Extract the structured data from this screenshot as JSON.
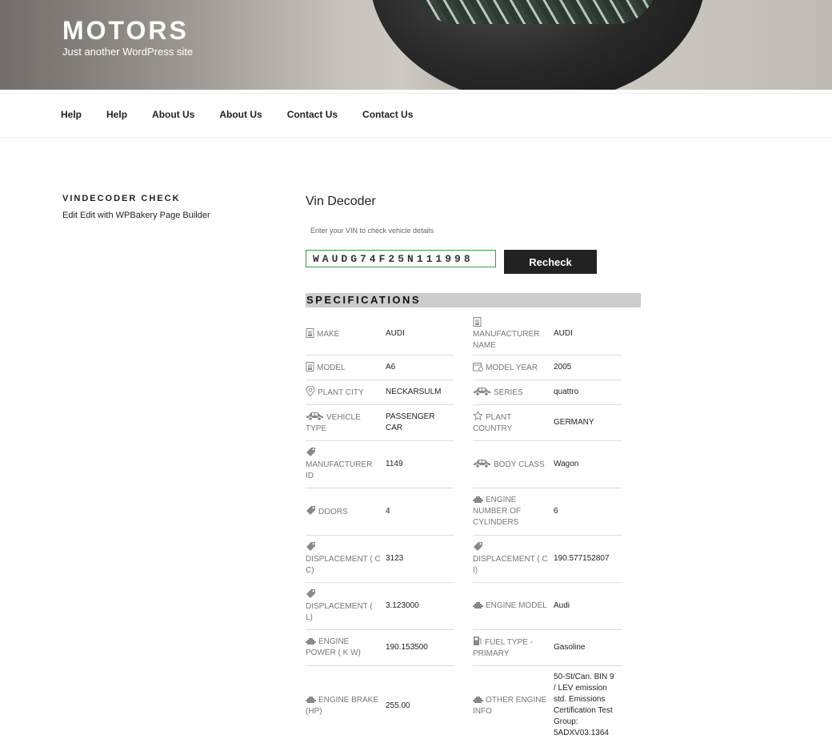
{
  "site": {
    "title": "MOTORS",
    "description": "Just another WordPress site"
  },
  "nav": [
    "Help",
    "Help",
    "About Us",
    "About Us",
    "Contact Us",
    "Contact Us"
  ],
  "sidebar": {
    "title": "VINDECODER CHECK",
    "text": "Edit Edit with WPBakery Page Builder"
  },
  "decoder": {
    "title": "Vin Decoder",
    "hint": "Enter your VIN to check vehicle details",
    "vin": "WAUDG74F25N111998",
    "button": "Recheck"
  },
  "specifications": {
    "title": "SPECIFICATIONS",
    "left": [
      {
        "icon": "document-icon",
        "label": "MAKE",
        "value": "AUDI"
      },
      {
        "icon": "document-icon",
        "label": "MODEL",
        "value": "A6"
      },
      {
        "icon": "location-pin-icon",
        "label": "PLANT CITY",
        "value": "NECKARSULM"
      },
      {
        "icon": "car-icon",
        "label": "VEHICLE TYPE",
        "value": "PASSENGER CAR"
      },
      {
        "icon": "tag-icon",
        "label": "MANUFACTURER ID",
        "value": "1149"
      },
      {
        "icon": "tag-icon",
        "label": "DOORS",
        "value": "4"
      },
      {
        "icon": "tag-icon",
        "label": "DISPLACEMENT ( C C)",
        "value": "3123"
      },
      {
        "icon": "tag-icon",
        "label": "DISPLACEMENT ( L)",
        "value": "3.123000"
      },
      {
        "icon": "engine-icon",
        "label": "ENGINE POWER ( K W)",
        "value": "190.153500"
      },
      {
        "icon": "engine-icon",
        "label": "ENGINE BRAKE (HP)",
        "value": "255.00"
      }
    ],
    "right": [
      {
        "icon": "document-icon",
        "label": "MANUFACTURER NAME",
        "value": "AUDI"
      },
      {
        "icon": "calendar-icon",
        "label": "MODEL YEAR",
        "value": "2005"
      },
      {
        "icon": "car-icon",
        "label": "SERIES",
        "value": "quattro"
      },
      {
        "icon": "star-icon",
        "label": "PLANT COUNTRY",
        "value": "GERMANY"
      },
      {
        "icon": "car-icon",
        "label": "BODY CLASS",
        "value": "Wagon"
      },
      {
        "icon": "engine-icon",
        "label": "ENGINE NUMBER OF CYLINDERS",
        "value": "6"
      },
      {
        "icon": "tag-icon",
        "label": "DISPLACEMENT ( C I)",
        "value": "190.577152807"
      },
      {
        "icon": "engine-icon",
        "label": "ENGINE MODEL",
        "value": "Audi"
      },
      {
        "icon": "fuel-icon",
        "label": "FUEL TYPE - PRIMARY",
        "value": "Gasoline"
      },
      {
        "icon": "engine-icon",
        "label": "OTHER ENGINE INFO",
        "value": "50-St/Can. BIN 9 / LEV emission std. Emissions Certification Test Group: 5ADXV03.1364"
      }
    ]
  }
}
